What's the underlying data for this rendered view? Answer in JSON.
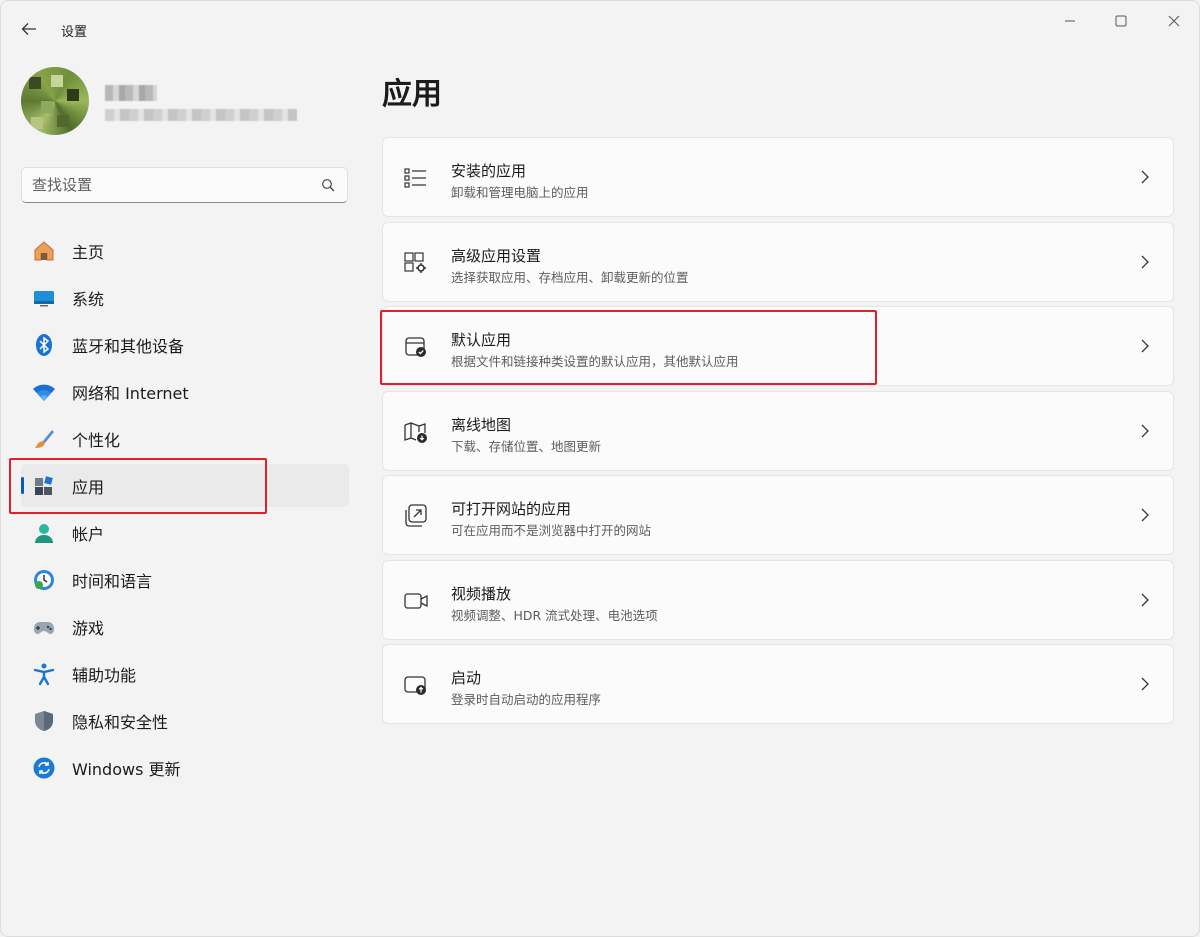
{
  "window": {
    "title": "设置"
  },
  "search": {
    "placeholder": "查找设置"
  },
  "sidebar": {
    "items": [
      {
        "label": "主页",
        "icon": "home-icon"
      },
      {
        "label": "系统",
        "icon": "display-icon"
      },
      {
        "label": "蓝牙和其他设备",
        "icon": "bluetooth-icon"
      },
      {
        "label": "网络和 Internet",
        "icon": "wifi-icon"
      },
      {
        "label": "个性化",
        "icon": "brush-icon"
      },
      {
        "label": "应用",
        "icon": "apps-icon",
        "active": true
      },
      {
        "label": "帐户",
        "icon": "account-icon"
      },
      {
        "label": "时间和语言",
        "icon": "clock-globe-icon"
      },
      {
        "label": "游戏",
        "icon": "gamepad-icon"
      },
      {
        "label": "辅助功能",
        "icon": "accessibility-icon"
      },
      {
        "label": "隐私和安全性",
        "icon": "shield-icon"
      },
      {
        "label": "Windows 更新",
        "icon": "update-icon"
      }
    ]
  },
  "main": {
    "title": "应用",
    "cards": [
      {
        "title": "安装的应用",
        "desc": "卸载和管理电脑上的应用",
        "icon": "list-icon"
      },
      {
        "title": "高级应用设置",
        "desc": "选择获取应用、存档应用、卸载更新的位置",
        "icon": "app-settings-icon"
      },
      {
        "title": "默认应用",
        "desc": "根据文件和链接种类设置的默认应用，其他默认应用",
        "icon": "default-app-icon"
      },
      {
        "title": "离线地图",
        "desc": "下载、存储位置、地图更新",
        "icon": "offline-map-icon"
      },
      {
        "title": "可打开网站的应用",
        "desc": "可在应用而不是浏览器中打开的网站",
        "icon": "open-link-icon"
      },
      {
        "title": "视频播放",
        "desc": "视频调整、HDR 流式处理、电池选项",
        "icon": "video-icon"
      },
      {
        "title": "启动",
        "desc": "登录时自动启动的应用程序",
        "icon": "startup-icon"
      }
    ]
  },
  "colors": {
    "accent": "#005fb8",
    "highlight": "#e0202b",
    "background": "#f3f3f3",
    "card": "#fbfbfb"
  }
}
